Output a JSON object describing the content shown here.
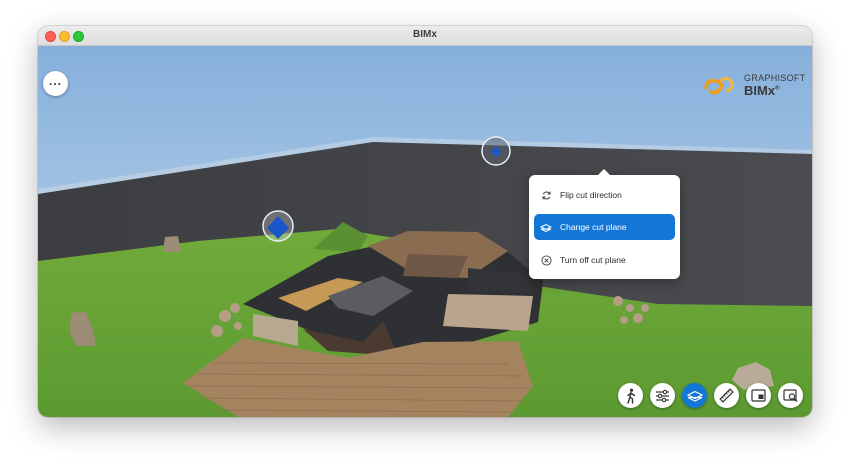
{
  "window": {
    "title": "BIMx"
  },
  "logo": {
    "brand": "GRAPHISOFT",
    "product": "BIMx",
    "product_mark": "®"
  },
  "menu": {
    "icon": "more-horizontal-icon",
    "glyph": "..."
  },
  "cut_plane_menu": {
    "items": [
      {
        "label": "Flip cut direction",
        "icon": "flip-icon",
        "selected": false
      },
      {
        "label": "Change cut plane",
        "icon": "cut-plane-icon",
        "selected": true
      },
      {
        "label": "Turn off cut plane",
        "icon": "close-circle-icon",
        "selected": false
      }
    ]
  },
  "toolbar": {
    "buttons": [
      {
        "icon": "walk-icon",
        "active": false
      },
      {
        "icon": "sliders-icon",
        "active": false
      },
      {
        "icon": "cut-plane-icon",
        "active": true
      },
      {
        "icon": "ruler-icon",
        "active": false
      },
      {
        "icon": "layout-icon",
        "active": false
      },
      {
        "icon": "search-view-icon",
        "active": false
      }
    ]
  },
  "colors": {
    "accent": "#1477d6",
    "grass": "#6aa43a",
    "cut_plane": "#3d3f42",
    "sky_top": "#8fb8e0",
    "deck": "#a4835f"
  }
}
